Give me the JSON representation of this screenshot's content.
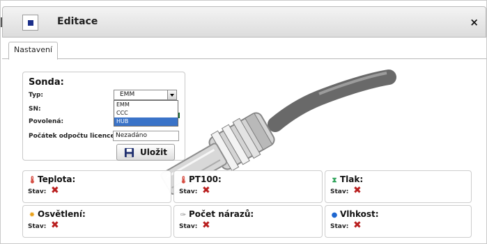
{
  "dialog": {
    "title": "Editace",
    "close_icon": "×",
    "tabs": [
      {
        "label": "Nastavení"
      }
    ]
  },
  "sonda": {
    "title": "Sonda:",
    "type_label": "Typ:",
    "type_value": "EMM",
    "type_options": [
      "EMM",
      "CCC",
      "HUB"
    ],
    "sn_label": "SN:",
    "allowed_label": "Povolená:",
    "license_label": "Počátek odpočtu licence:",
    "license_value": "Nezadáno",
    "save_label": "Uložit"
  },
  "sensors": [
    {
      "title": "Teplota:",
      "icon": "thermometer-icon",
      "state_label": "Stav:"
    },
    {
      "title": "PT100:",
      "icon": "thermometer-icon",
      "state_label": "Stav:"
    },
    {
      "title": "Tlak:",
      "icon": "pressure-icon",
      "state_label": "Stav:"
    },
    {
      "title": "Osvětlení:",
      "icon": "sun-icon",
      "state_label": "Stav:"
    },
    {
      "title": "Počet nárazů:",
      "icon": "impact-icon",
      "state_label": "Stav:"
    },
    {
      "title": "Vlhkost:",
      "icon": "humidity-drop-icon",
      "state_label": "Stav:"
    }
  ],
  "colors": {
    "accent": "#1b2f8a",
    "status_inactive": "#b91f1f",
    "selected_option": "#3a73c8"
  }
}
